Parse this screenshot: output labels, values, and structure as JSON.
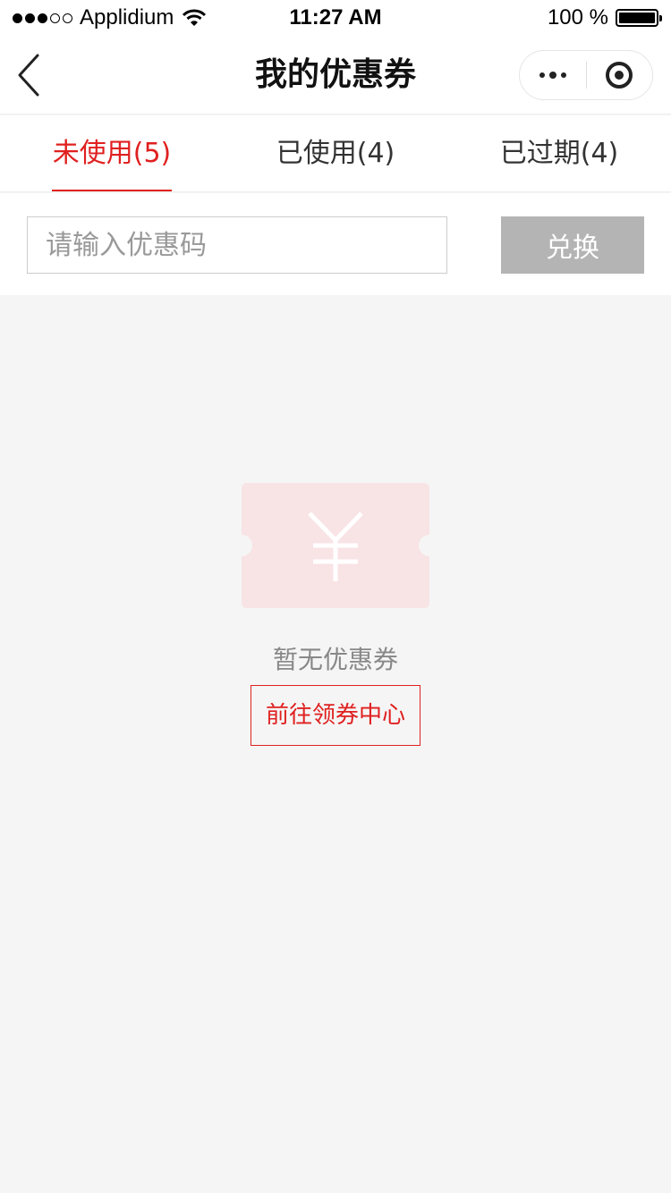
{
  "status_bar": {
    "carrier": "Applidium",
    "time": "11:27 AM",
    "battery": "100 %",
    "signal_bars_filled": 3,
    "signal_bars_total": 5
  },
  "nav": {
    "title": "我的优惠券"
  },
  "tabs": [
    {
      "label": "未使用(5)",
      "active": true
    },
    {
      "label": "已使用(4)",
      "active": false
    },
    {
      "label": "已过期(4)",
      "active": false
    }
  ],
  "redeem": {
    "placeholder": "请输入优惠码",
    "value": "",
    "button_label": "兑换"
  },
  "empty_state": {
    "icon": "coupon-yen-icon",
    "message": "暂无优惠券",
    "action_label": "前往领券中心"
  },
  "colors": {
    "accent": "#e02020",
    "disabled_button": "#b4b4b4",
    "background": "#f5f5f5",
    "coupon_icon": "#f8e3e5"
  }
}
